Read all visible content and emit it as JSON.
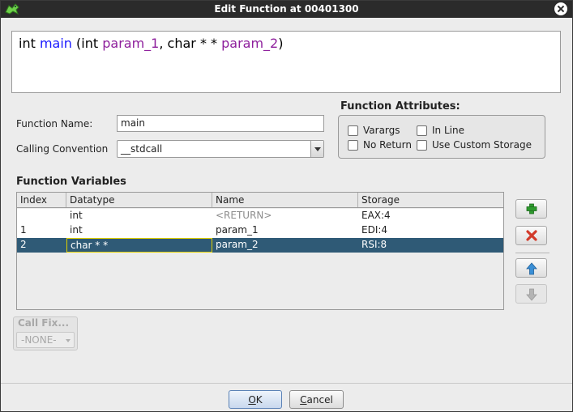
{
  "window": {
    "title": "Edit Function at 00401300"
  },
  "signature": {
    "return_type": "int",
    "name": "main",
    "open": "(",
    "p1_type": "int",
    "p1_name": "param_1",
    "comma": ",",
    "p2_type": "char * *",
    "p2_name": "param_2",
    "close": ")"
  },
  "form": {
    "function_name_label": "Function Name:",
    "function_name_value": "main",
    "calling_convention_label": "Calling Convention",
    "calling_convention_value": "__stdcall"
  },
  "attributes": {
    "title": "Function Attributes:",
    "varargs": "Varargs",
    "inline": "In Line",
    "no_return": "No Return",
    "custom_storage": "Use Custom Storage"
  },
  "variables": {
    "title": "Function Variables",
    "columns": [
      "Index",
      "Datatype",
      "Name",
      "Storage"
    ],
    "rows": [
      {
        "index": "",
        "datatype": "int",
        "name": "<RETURN>",
        "storage": "EAX:4"
      },
      {
        "index": "1",
        "datatype": "int",
        "name": "param_1",
        "storage": "EDI:4"
      },
      {
        "index": "2",
        "datatype": "char * *",
        "name": "param_2",
        "storage": "RSI:8"
      }
    ]
  },
  "call_fixup": {
    "title": "Call Fix...",
    "value": "-NONE-"
  },
  "buttons": {
    "ok_mnemonic": "O",
    "ok_rest": "K",
    "cancel_mnemonic": "C",
    "cancel_rest": "ancel"
  },
  "colors": {
    "selected_row": "#2f5a76",
    "function_name": "#1a1aff",
    "parameter": "#8e1f9c",
    "add_icon": "#2e9b2e",
    "remove_icon": "#d23a2a",
    "move_up_icon": "#3a8fd6"
  }
}
